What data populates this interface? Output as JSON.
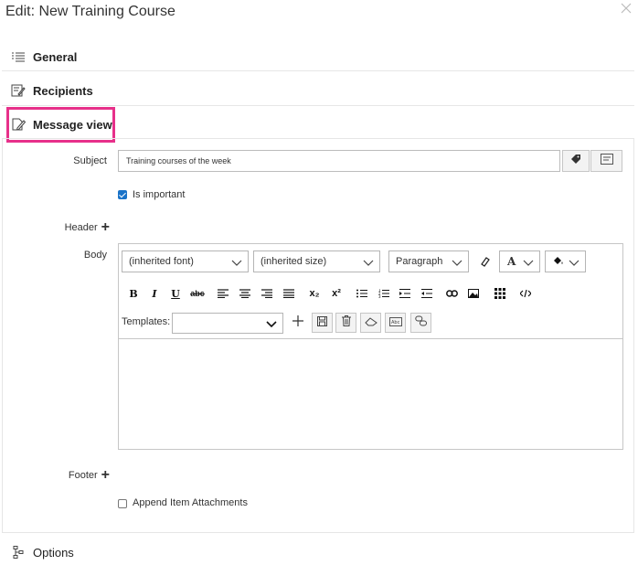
{
  "dialog": {
    "title": "Edit: New Training Course"
  },
  "sections": {
    "general": "General",
    "recipients": "Recipients",
    "message_view": "Message view",
    "options": "Options"
  },
  "form": {
    "subject_label": "Subject",
    "subject_value": "Training courses of the week",
    "is_important_label": "Is important",
    "is_important_checked": true,
    "header_label": "Header",
    "body_label": "Body",
    "footer_label": "Footer",
    "append_label": "Append Item Attachments",
    "append_checked": false
  },
  "editor": {
    "font_value": "(inherited font)",
    "size_value": "(inherited size)",
    "paragraph_value": "Paragraph",
    "font_color_glyph": "A",
    "bold": "B",
    "italic": "I",
    "underline": "U",
    "strike": "abc",
    "subscript": "x₂",
    "superscript": "x²",
    "templates_label": "Templates:",
    "templates_value": ""
  },
  "colors": {
    "highlight": "#e7308a",
    "checkbox": "#1a73c8"
  }
}
